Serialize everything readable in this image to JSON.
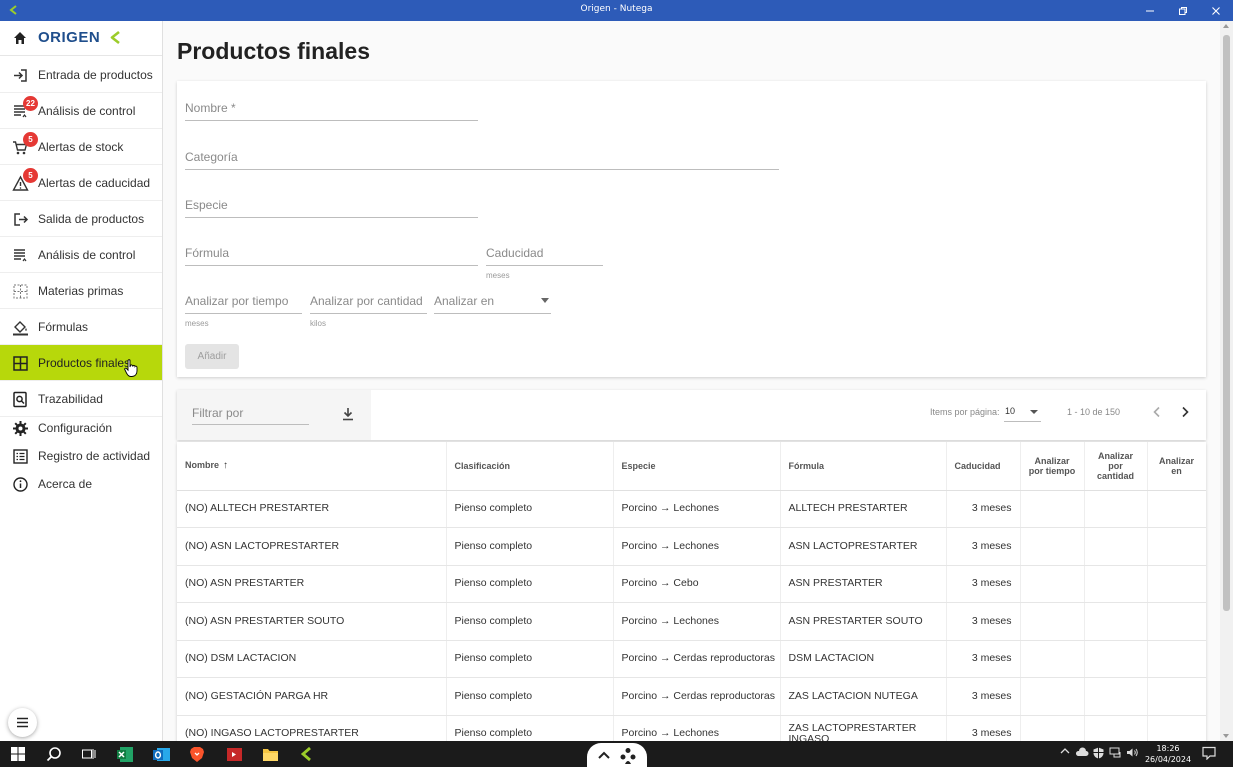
{
  "window": {
    "title": "Origen - Nutega",
    "minimize_icon": "minimize-icon",
    "restore_icon": "restore-icon",
    "close_icon": "close-icon"
  },
  "sidebar": {
    "logo_text": "ORIGEN",
    "brand_color": "#1f4e8c",
    "active_color": "#b7d80b",
    "items": [
      {
        "label": "Entrada de productos",
        "icon": "login-icon",
        "badge": ""
      },
      {
        "label": "Análisis de control",
        "icon": "list-icon",
        "badge": "22"
      },
      {
        "label": "Alertas de stock",
        "icon": "cart-icon",
        "badge": "5"
      },
      {
        "label": "Alertas de caducidad",
        "icon": "warning-icon",
        "badge": "5"
      },
      {
        "label": "Salida de productos",
        "icon": "logout-icon",
        "badge": ""
      },
      {
        "label": "Análisis de control",
        "icon": "list-icon",
        "badge": ""
      },
      {
        "label": "Materias primas",
        "icon": "grid-dots-icon",
        "badge": ""
      },
      {
        "label": "Fórmulas",
        "icon": "paint-bucket-icon",
        "badge": ""
      },
      {
        "label": "Productos finales",
        "icon": "table-grid-icon",
        "badge": ""
      },
      {
        "label": "Trazabilidad",
        "icon": "search-doc-icon",
        "badge": ""
      },
      {
        "label": "Configuración",
        "icon": "gear-icon",
        "badge": ""
      },
      {
        "label": "Registro de actividad",
        "icon": "list-box-icon",
        "badge": ""
      },
      {
        "label": "Acerca de",
        "icon": "info-icon",
        "badge": ""
      }
    ]
  },
  "page": {
    "title": "Productos finales"
  },
  "form": {
    "nombre": "Nombre *",
    "categoria": "Categoría",
    "especie": "Especie",
    "formula": "Fórmula",
    "caducidad": "Caducidad",
    "caducidad_hint": "meses",
    "analizar_tiempo": "Analizar por tiempo",
    "analizar_tiempo_hint": "meses",
    "analizar_cantidad": "Analizar por cantidad",
    "analizar_cantidad_hint": "kilos",
    "analizar_en": "Analizar en",
    "add_button": "Añadir"
  },
  "filter": {
    "placeholder": "Filtrar por",
    "items_per_page_label": "Items por página:",
    "items_per_page": "10",
    "range": "1 - 10 de 150"
  },
  "table": {
    "headers": {
      "nombre": "Nombre",
      "clasificacion": "Clasificación",
      "especie": "Especie",
      "formula": "Fórmula",
      "caducidad": "Caducidad",
      "tiempo": "Analizar por tiempo",
      "cantidad": "Analizar por cantidad",
      "en": "Analizar en"
    },
    "rows": [
      {
        "nombre": "(NO) ALLTECH PRESTARTER",
        "clasificacion": "Pienso completo",
        "especie": "Porcino → Lechones",
        "formula": "ALLTECH PRESTARTER",
        "caducidad": "3 meses"
      },
      {
        "nombre": "(NO) ASN LACTOPRESTARTER",
        "clasificacion": "Pienso completo",
        "especie": "Porcino → Lechones",
        "formula": "ASN LACTOPRESTARTER",
        "caducidad": "3 meses"
      },
      {
        "nombre": "(NO) ASN PRESTARTER",
        "clasificacion": "Pienso completo",
        "especie": "Porcino → Cebo",
        "formula": "ASN PRESTARTER",
        "caducidad": "3 meses"
      },
      {
        "nombre": "(NO) ASN PRESTARTER SOUTO",
        "clasificacion": "Pienso completo",
        "especie": "Porcino → Lechones",
        "formula": "ASN PRESTARTER SOUTO",
        "caducidad": "3 meses"
      },
      {
        "nombre": "(NO) DSM LACTACION",
        "clasificacion": "Pienso completo",
        "especie": "Porcino → Cerdas reproductoras",
        "formula": "DSM LACTACION",
        "caducidad": "3 meses"
      },
      {
        "nombre": "(NO) GESTACIÓN PARGA HR",
        "clasificacion": "Pienso completo",
        "especie": "Porcino → Cerdas reproductoras",
        "formula": "ZAS LACTACION NUTEGA",
        "caducidad": "3 meses"
      },
      {
        "nombre": "(NO) INGASO LACTOPRESTARTER",
        "clasificacion": "Pienso completo",
        "especie": "Porcino → Lechones",
        "formula": "ZAS LACTOPRESTARTER INGASO",
        "caducidad": "3 meses"
      }
    ]
  },
  "taskbar": {
    "time": "18:26",
    "date": "26/04/2024"
  }
}
